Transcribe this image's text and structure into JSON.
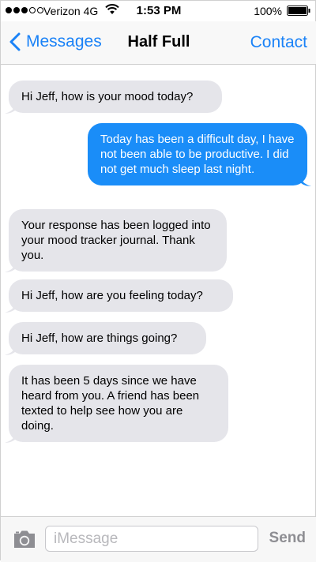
{
  "status_bar": {
    "signal_full": 3,
    "signal_total": 5,
    "carrier": "Verizon 4G",
    "time": "1:53 PM",
    "battery_percent": "100%",
    "battery_level": 1.0
  },
  "nav": {
    "back_label": "Messages",
    "title": "Half Full",
    "right_label": "Contact"
  },
  "messages": [
    {
      "direction": "incoming",
      "text": "Hi Jeff, how is your mood today?"
    },
    {
      "direction": "outgoing",
      "text": "Today has been a difficult day, I have not been able to be productive. I did not get much sleep last night."
    },
    {
      "direction": "incoming",
      "text": "Your response has been logged into your mood tracker journal. Thank you."
    },
    {
      "direction": "incoming",
      "text": "Hi Jeff, how are you feeling today?"
    },
    {
      "direction": "incoming",
      "text": "Hi Jeff, how are things going?"
    },
    {
      "direction": "incoming",
      "text": "It has been 5 days since we have heard from you. A friend has been texted to help see how you are doing."
    }
  ],
  "input_bar": {
    "placeholder": "iMessage",
    "value": "",
    "send_label": "Send"
  },
  "colors": {
    "accent": "#1a82f7",
    "incoming_bubble": "#e5e5ea",
    "outgoing_bubble": "#1a8df8"
  },
  "icons": {
    "back": "chevron-left-icon",
    "camera": "camera-icon",
    "wifi": "wifi-icon",
    "battery": "battery-icon"
  }
}
